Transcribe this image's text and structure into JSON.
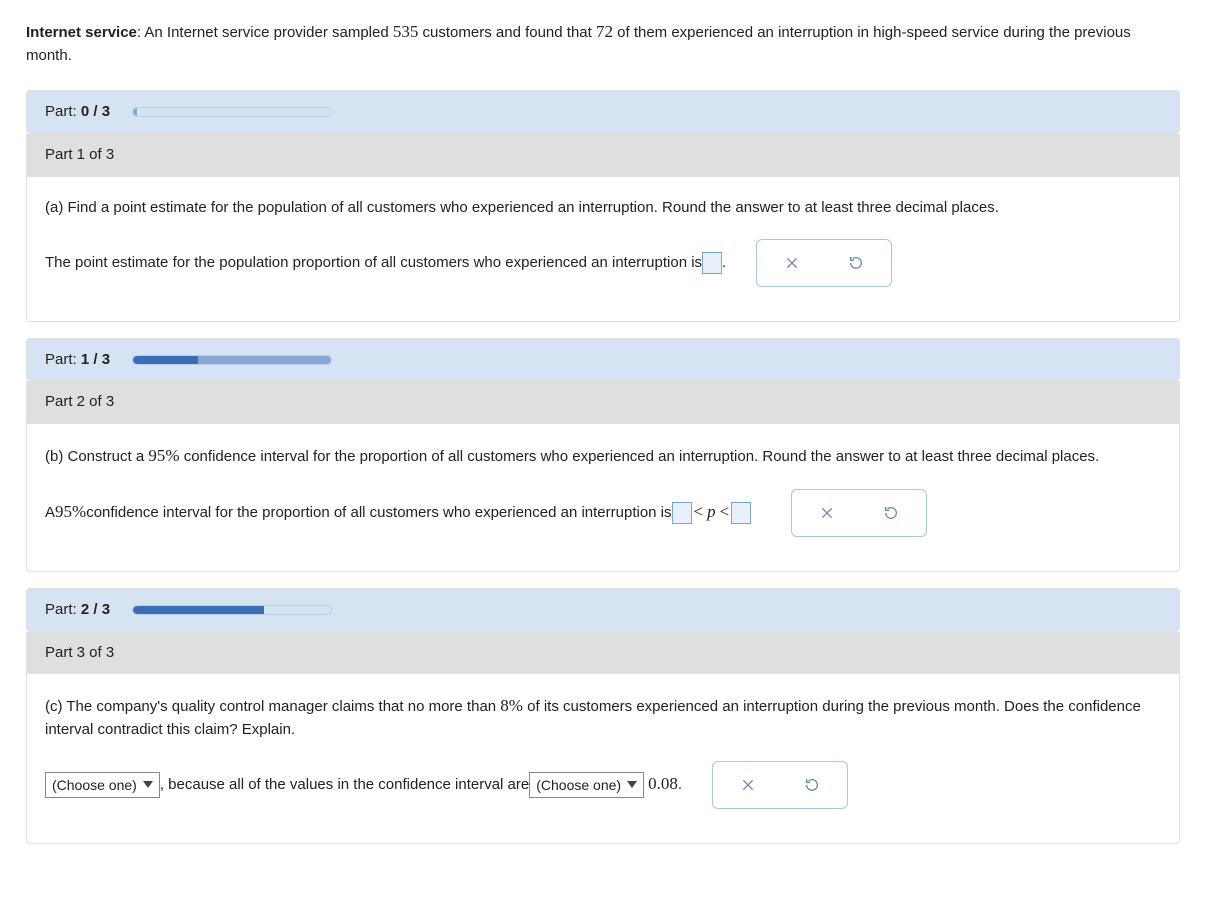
{
  "intro": {
    "title": "Internet service",
    "pre": ": An Internet service provider sampled ",
    "n_sample": "535",
    "mid": " customers and found that ",
    "n_event": "72",
    "post": " of them experienced an interruption in high-speed service during the previous month."
  },
  "progress": [
    {
      "label_prefix": "Part: ",
      "done": "0",
      "sep": " / ",
      "total": "3",
      "percent": 0
    },
    {
      "label_prefix": "Part: ",
      "done": "1",
      "sep": " / ",
      "total": "3",
      "percent": 33
    },
    {
      "label_prefix": "Part: ",
      "done": "2",
      "sep": " / ",
      "total": "3",
      "percent": 66
    }
  ],
  "parts": {
    "p1": {
      "title": "Part 1 of 3",
      "prompt": "(a) Find a point estimate for the population of all customers who experienced an interruption. Round the answer to at least three decimal places.",
      "answer_lead": "The point estimate for the population proportion of all customers who experienced an interruption is ",
      "period": "."
    },
    "p2": {
      "title": "Part 2 of 3",
      "prompt_pre": "(b) Construct a ",
      "conf": "95%",
      "prompt_post": " confidence interval for the proportion of all customers who experienced an interruption. Round the answer to at least three decimal places.",
      "answer_pre": "A ",
      "answer_conf": "95%",
      "answer_mid": " confidence interval for the proportion of all customers who experienced an interruption is ",
      "lt1": "<",
      "p": "p",
      "lt2": "<"
    },
    "p3": {
      "title": "Part 3 of 3",
      "prompt_pre": "(c) The company's quality control manager claims that no more than ",
      "thresh_pct": "8%",
      "prompt_post": " of its customers experienced an interruption during the previous month. Does the confidence interval contradict this claim? Explain.",
      "choose_label": "(Choose one)",
      "because": ", because all of the values in the confidence interval are ",
      "thresh_val": "0.08",
      "period": "."
    }
  }
}
